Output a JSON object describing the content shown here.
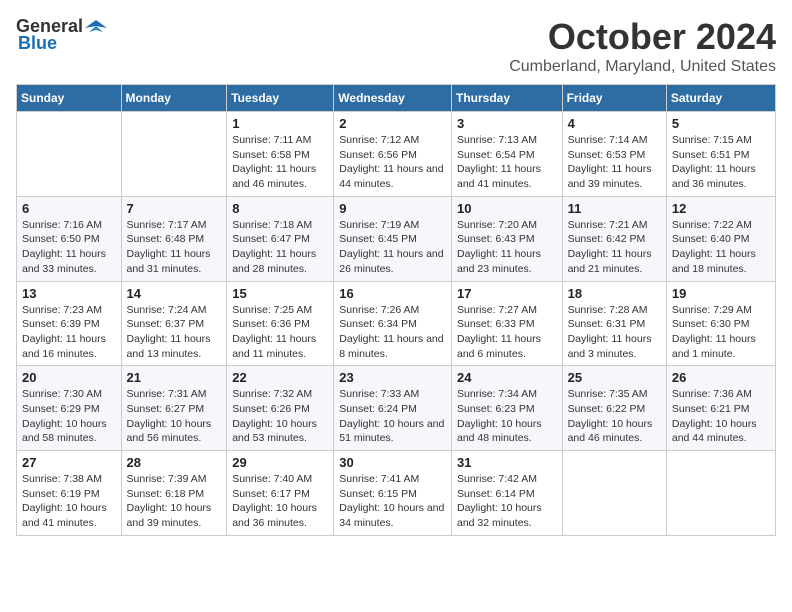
{
  "header": {
    "logo_general": "General",
    "logo_blue": "Blue",
    "month": "October 2024",
    "location": "Cumberland, Maryland, United States"
  },
  "weekdays": [
    "Sunday",
    "Monday",
    "Tuesday",
    "Wednesday",
    "Thursday",
    "Friday",
    "Saturday"
  ],
  "weeks": [
    [
      {
        "day": "",
        "sunrise": "",
        "sunset": "",
        "daylight": ""
      },
      {
        "day": "",
        "sunrise": "",
        "sunset": "",
        "daylight": ""
      },
      {
        "day": "1",
        "sunrise": "Sunrise: 7:11 AM",
        "sunset": "Sunset: 6:58 PM",
        "daylight": "Daylight: 11 hours and 46 minutes."
      },
      {
        "day": "2",
        "sunrise": "Sunrise: 7:12 AM",
        "sunset": "Sunset: 6:56 PM",
        "daylight": "Daylight: 11 hours and 44 minutes."
      },
      {
        "day": "3",
        "sunrise": "Sunrise: 7:13 AM",
        "sunset": "Sunset: 6:54 PM",
        "daylight": "Daylight: 11 hours and 41 minutes."
      },
      {
        "day": "4",
        "sunrise": "Sunrise: 7:14 AM",
        "sunset": "Sunset: 6:53 PM",
        "daylight": "Daylight: 11 hours and 39 minutes."
      },
      {
        "day": "5",
        "sunrise": "Sunrise: 7:15 AM",
        "sunset": "Sunset: 6:51 PM",
        "daylight": "Daylight: 11 hours and 36 minutes."
      }
    ],
    [
      {
        "day": "6",
        "sunrise": "Sunrise: 7:16 AM",
        "sunset": "Sunset: 6:50 PM",
        "daylight": "Daylight: 11 hours and 33 minutes."
      },
      {
        "day": "7",
        "sunrise": "Sunrise: 7:17 AM",
        "sunset": "Sunset: 6:48 PM",
        "daylight": "Daylight: 11 hours and 31 minutes."
      },
      {
        "day": "8",
        "sunrise": "Sunrise: 7:18 AM",
        "sunset": "Sunset: 6:47 PM",
        "daylight": "Daylight: 11 hours and 28 minutes."
      },
      {
        "day": "9",
        "sunrise": "Sunrise: 7:19 AM",
        "sunset": "Sunset: 6:45 PM",
        "daylight": "Daylight: 11 hours and 26 minutes."
      },
      {
        "day": "10",
        "sunrise": "Sunrise: 7:20 AM",
        "sunset": "Sunset: 6:43 PM",
        "daylight": "Daylight: 11 hours and 23 minutes."
      },
      {
        "day": "11",
        "sunrise": "Sunrise: 7:21 AM",
        "sunset": "Sunset: 6:42 PM",
        "daylight": "Daylight: 11 hours and 21 minutes."
      },
      {
        "day": "12",
        "sunrise": "Sunrise: 7:22 AM",
        "sunset": "Sunset: 6:40 PM",
        "daylight": "Daylight: 11 hours and 18 minutes."
      }
    ],
    [
      {
        "day": "13",
        "sunrise": "Sunrise: 7:23 AM",
        "sunset": "Sunset: 6:39 PM",
        "daylight": "Daylight: 11 hours and 16 minutes."
      },
      {
        "day": "14",
        "sunrise": "Sunrise: 7:24 AM",
        "sunset": "Sunset: 6:37 PM",
        "daylight": "Daylight: 11 hours and 13 minutes."
      },
      {
        "day": "15",
        "sunrise": "Sunrise: 7:25 AM",
        "sunset": "Sunset: 6:36 PM",
        "daylight": "Daylight: 11 hours and 11 minutes."
      },
      {
        "day": "16",
        "sunrise": "Sunrise: 7:26 AM",
        "sunset": "Sunset: 6:34 PM",
        "daylight": "Daylight: 11 hours and 8 minutes."
      },
      {
        "day": "17",
        "sunrise": "Sunrise: 7:27 AM",
        "sunset": "Sunset: 6:33 PM",
        "daylight": "Daylight: 11 hours and 6 minutes."
      },
      {
        "day": "18",
        "sunrise": "Sunrise: 7:28 AM",
        "sunset": "Sunset: 6:31 PM",
        "daylight": "Daylight: 11 hours and 3 minutes."
      },
      {
        "day": "19",
        "sunrise": "Sunrise: 7:29 AM",
        "sunset": "Sunset: 6:30 PM",
        "daylight": "Daylight: 11 hours and 1 minute."
      }
    ],
    [
      {
        "day": "20",
        "sunrise": "Sunrise: 7:30 AM",
        "sunset": "Sunset: 6:29 PM",
        "daylight": "Daylight: 10 hours and 58 minutes."
      },
      {
        "day": "21",
        "sunrise": "Sunrise: 7:31 AM",
        "sunset": "Sunset: 6:27 PM",
        "daylight": "Daylight: 10 hours and 56 minutes."
      },
      {
        "day": "22",
        "sunrise": "Sunrise: 7:32 AM",
        "sunset": "Sunset: 6:26 PM",
        "daylight": "Daylight: 10 hours and 53 minutes."
      },
      {
        "day": "23",
        "sunrise": "Sunrise: 7:33 AM",
        "sunset": "Sunset: 6:24 PM",
        "daylight": "Daylight: 10 hours and 51 minutes."
      },
      {
        "day": "24",
        "sunrise": "Sunrise: 7:34 AM",
        "sunset": "Sunset: 6:23 PM",
        "daylight": "Daylight: 10 hours and 48 minutes."
      },
      {
        "day": "25",
        "sunrise": "Sunrise: 7:35 AM",
        "sunset": "Sunset: 6:22 PM",
        "daylight": "Daylight: 10 hours and 46 minutes."
      },
      {
        "day": "26",
        "sunrise": "Sunrise: 7:36 AM",
        "sunset": "Sunset: 6:21 PM",
        "daylight": "Daylight: 10 hours and 44 minutes."
      }
    ],
    [
      {
        "day": "27",
        "sunrise": "Sunrise: 7:38 AM",
        "sunset": "Sunset: 6:19 PM",
        "daylight": "Daylight: 10 hours and 41 minutes."
      },
      {
        "day": "28",
        "sunrise": "Sunrise: 7:39 AM",
        "sunset": "Sunset: 6:18 PM",
        "daylight": "Daylight: 10 hours and 39 minutes."
      },
      {
        "day": "29",
        "sunrise": "Sunrise: 7:40 AM",
        "sunset": "Sunset: 6:17 PM",
        "daylight": "Daylight: 10 hours and 36 minutes."
      },
      {
        "day": "30",
        "sunrise": "Sunrise: 7:41 AM",
        "sunset": "Sunset: 6:15 PM",
        "daylight": "Daylight: 10 hours and 34 minutes."
      },
      {
        "day": "31",
        "sunrise": "Sunrise: 7:42 AM",
        "sunset": "Sunset: 6:14 PM",
        "daylight": "Daylight: 10 hours and 32 minutes."
      },
      {
        "day": "",
        "sunrise": "",
        "sunset": "",
        "daylight": ""
      },
      {
        "day": "",
        "sunrise": "",
        "sunset": "",
        "daylight": ""
      }
    ]
  ]
}
